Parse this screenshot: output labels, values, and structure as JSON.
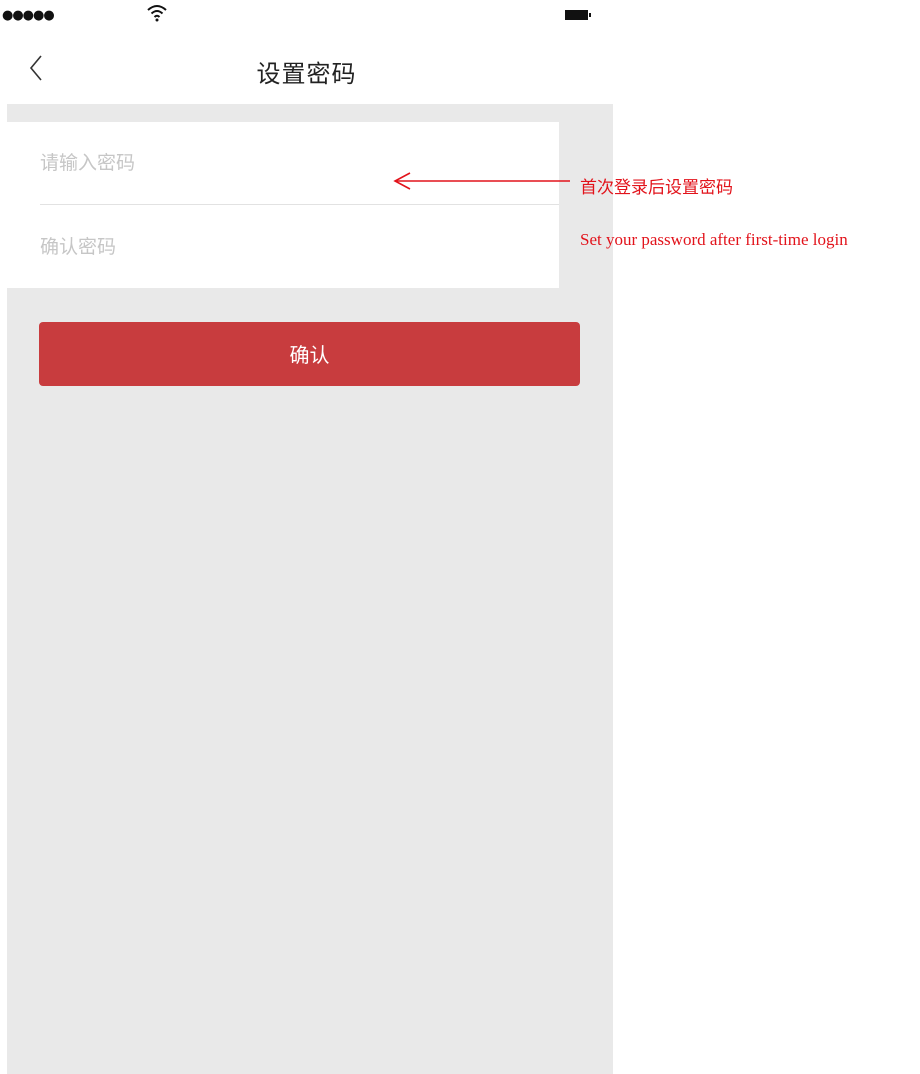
{
  "status_bar": {
    "signal": "●●●●●"
  },
  "nav": {
    "title": "设置密码",
    "back_icon": "chevron-left-icon"
  },
  "form": {
    "password_placeholder": "请输入密码",
    "confirm_placeholder": "确认密码"
  },
  "confirm_button": {
    "label": "确认"
  },
  "annotation": {
    "cn": "首次登录后设置密码",
    "en": "Set your password after first-time login",
    "color": "#e2131b"
  },
  "colors": {
    "accent": "#c83c3e",
    "background": "#e9e9e9"
  }
}
